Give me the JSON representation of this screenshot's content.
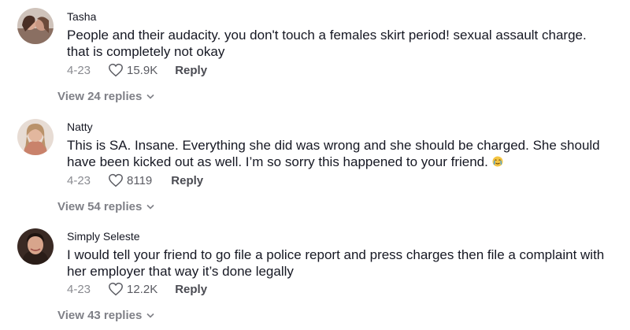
{
  "comments": [
    {
      "username": "Tasha",
      "text": "People and their audacity. you don't touch a females skirt period! sexual assault charge. that is completely not okay",
      "date": "4-23",
      "likes": "15.9K",
      "reply_label": "Reply",
      "view_replies": "View 24 replies"
    },
    {
      "username": "Natty",
      "text": "This is SA. Insane. Everything she did was wrong and she should be charged. She should have been kicked out as well. I’m so sorry this happened to your friend.",
      "emoji": "crying-face",
      "date": "4-23",
      "likes": "8119",
      "reply_label": "Reply",
      "view_replies": "View 54 replies"
    },
    {
      "username": "Simply Seleste",
      "text": "I would tell your friend to go file a police report and press charges then file a complaint with her employer that way it’s done legally",
      "date": "4-23",
      "likes": "12.2K",
      "reply_label": "Reply",
      "view_replies": "View 43 replies"
    }
  ],
  "icons": {
    "like": "heart-outline-icon",
    "expand": "chevron-down-icon"
  },
  "colors": {
    "text": "#161823",
    "secondary": "#8a8b91",
    "reply": "#4a4b52"
  }
}
